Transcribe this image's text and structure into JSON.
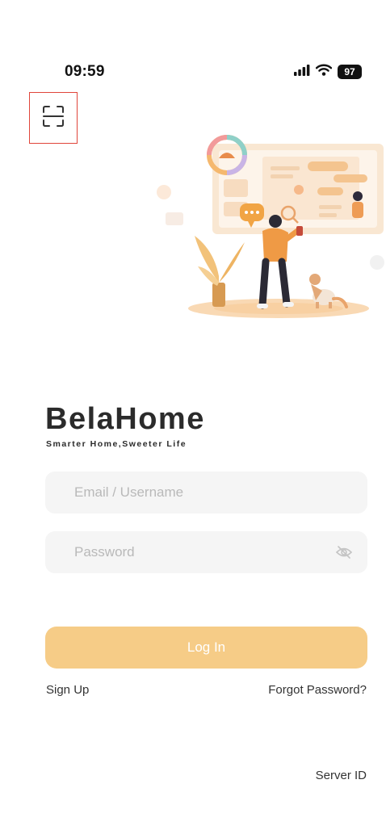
{
  "status_bar": {
    "time": "09:59",
    "battery": "97",
    "signal_icon": "cellular-signal-icon",
    "wifi_icon": "wifi-icon"
  },
  "header": {
    "scan_icon": "scan-qr-icon"
  },
  "brand": {
    "name": "BelaHome",
    "tagline": "Smarter Home,Sweeter Life"
  },
  "form": {
    "email_placeholder": "Email / Username",
    "email_value": "",
    "password_placeholder": "Password",
    "password_value": "",
    "visibility_icon": "eye-off-icon",
    "login_label": "Log In"
  },
  "links": {
    "sign_up": "Sign Up",
    "forgot_password": "Forgot Password?",
    "server_id": "Server ID"
  },
  "colors": {
    "accent": "#f6cc87",
    "field_bg": "#f5f5f5",
    "placeholder": "#b9b9b9",
    "highlight_border": "#e0453a"
  }
}
